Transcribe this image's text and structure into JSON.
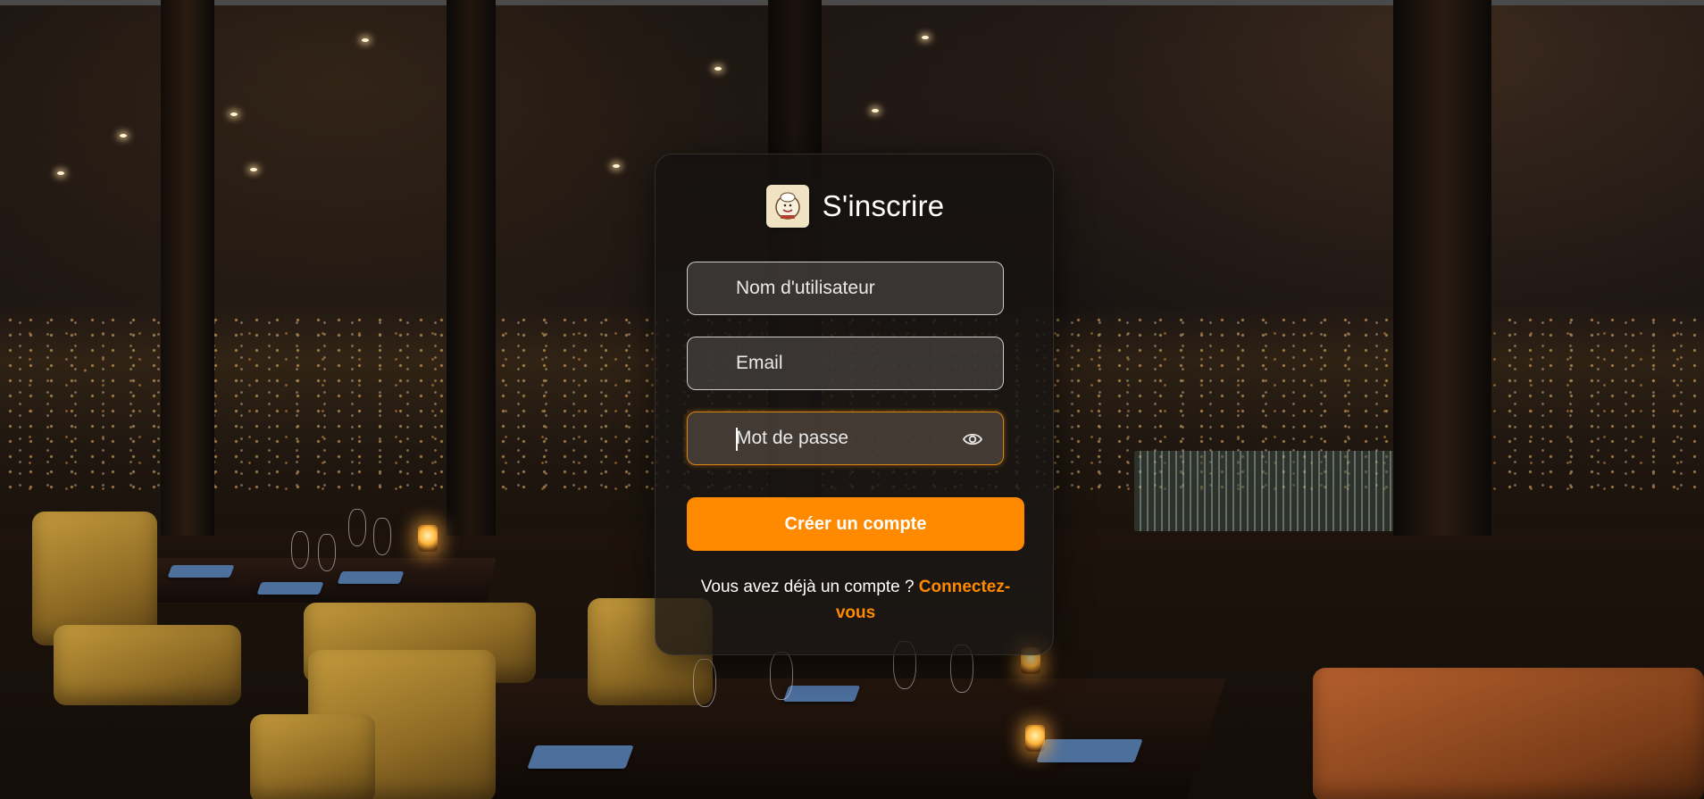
{
  "page": {
    "title": "S'inscrire",
    "logo_icon": "chef-logo-icon"
  },
  "form": {
    "username_placeholder": "Nom d'utilisateur",
    "email_placeholder": "Email",
    "password_placeholder": "Mot de passe",
    "password_toggle_icon": "eye-icon",
    "submit_label": "Créer un compte"
  },
  "footer": {
    "prompt": "Vous avez déjà un compte ?",
    "login_link": "Connectez-vous"
  },
  "colors": {
    "accent": "#ff8a00",
    "focus_border": "#d98214"
  }
}
